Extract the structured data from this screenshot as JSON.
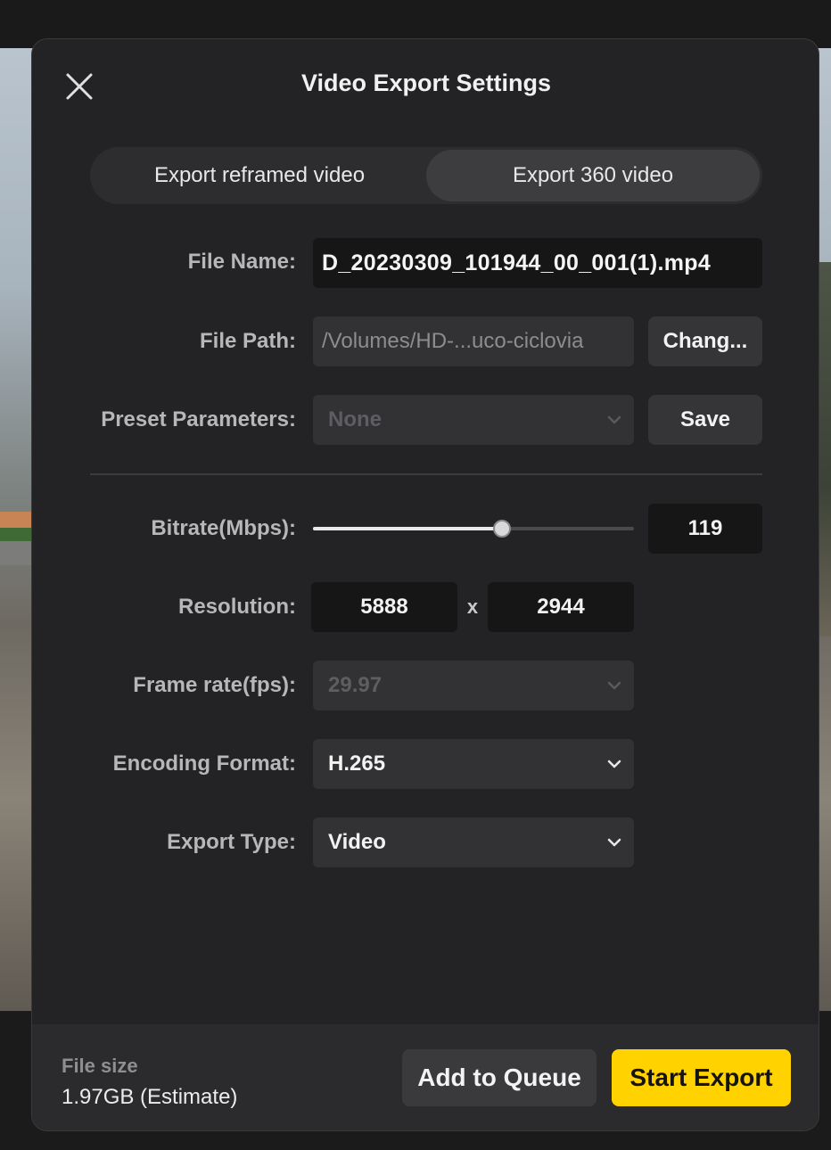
{
  "dialog": {
    "title": "Video Export Settings"
  },
  "tabs": [
    {
      "label": "Export reframed video",
      "active": false
    },
    {
      "label": "Export 360 video",
      "active": true
    }
  ],
  "file_name": {
    "label": "File Name:",
    "value": "D_20230309_101944_00_001(1).mp4"
  },
  "file_path": {
    "label": "File Path:",
    "value": "/Volumes/HD-...uco-ciclovia",
    "change_label": "Chang..."
  },
  "preset": {
    "label": "Preset Parameters:",
    "value": "None",
    "save_label": "Save"
  },
  "bitrate": {
    "label": "Bitrate(Mbps):",
    "value": "119",
    "slider_fraction": 0.59
  },
  "resolution": {
    "label": "Resolution:",
    "width": "5888",
    "separator": "x",
    "height": "2944"
  },
  "frame_rate": {
    "label": "Frame rate(fps):",
    "value": "29.97"
  },
  "encoding": {
    "label": "Encoding Format:",
    "value": "H.265"
  },
  "export_type": {
    "label": "Export Type:",
    "value": "Video"
  },
  "footer": {
    "file_size_label": "File size",
    "file_size_value": "1.97GB (Estimate)",
    "queue_label": "Add to Queue",
    "export_label": "Start Export"
  },
  "colors": {
    "accent": "#ffd200",
    "panel": "#232325",
    "field_dark": "#161617",
    "field_mid": "#323235"
  },
  "icons": [
    "close-icon",
    "chevron-down-icon"
  ]
}
